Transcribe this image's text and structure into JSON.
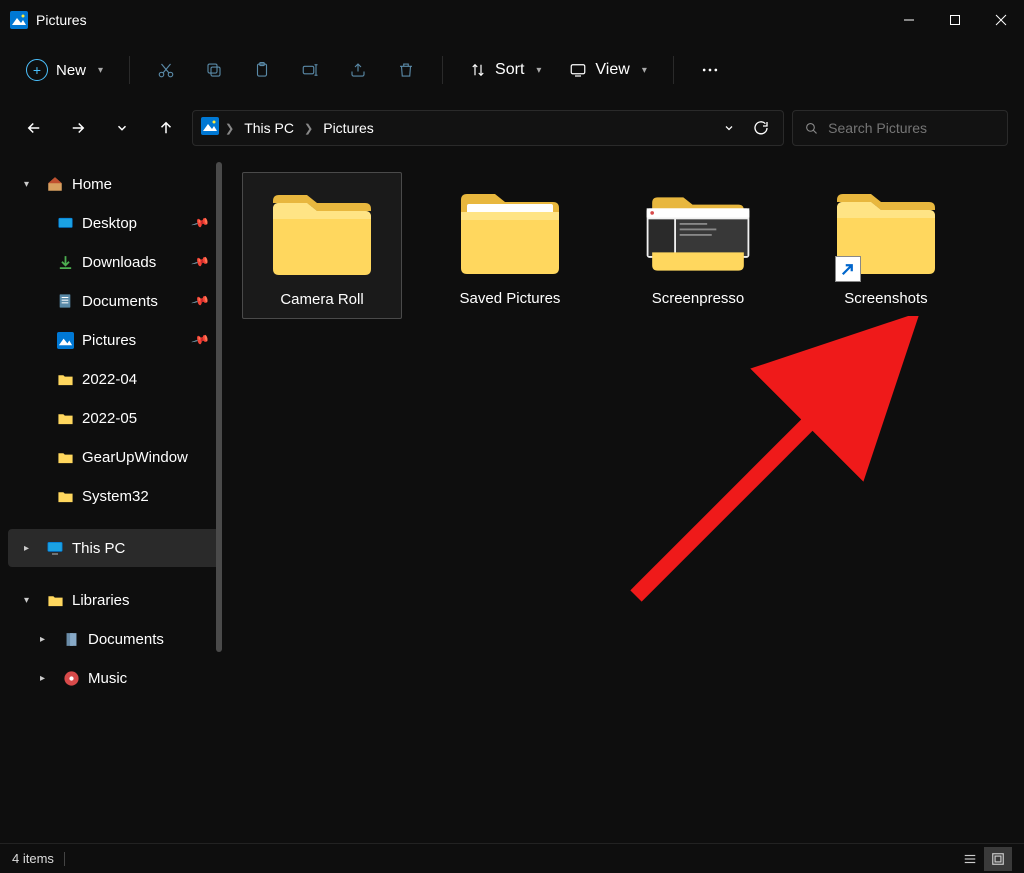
{
  "window": {
    "title": "Pictures"
  },
  "toolbar": {
    "new_label": "New",
    "sort_label": "Sort",
    "view_label": "View"
  },
  "breadcrumb": {
    "items": [
      "This PC",
      "Pictures"
    ]
  },
  "search": {
    "placeholder": "Search Pictures"
  },
  "sidebar": {
    "home_label": "Home",
    "quick": [
      {
        "label": "Desktop",
        "pinned": true,
        "icon": "desktop"
      },
      {
        "label": "Downloads",
        "pinned": true,
        "icon": "download"
      },
      {
        "label": "Documents",
        "pinned": true,
        "icon": "document"
      },
      {
        "label": "Pictures",
        "pinned": true,
        "icon": "pictures"
      },
      {
        "label": "2022-04",
        "pinned": false,
        "icon": "folder"
      },
      {
        "label": "2022-05",
        "pinned": false,
        "icon": "folder"
      },
      {
        "label": "GearUpWindow",
        "pinned": false,
        "icon": "folder"
      },
      {
        "label": "System32",
        "pinned": false,
        "icon": "folder"
      }
    ],
    "this_pc_label": "This PC",
    "libraries_label": "Libraries",
    "libraries": [
      {
        "label": "Documents",
        "icon": "lib-doc"
      },
      {
        "label": "Music",
        "icon": "lib-music"
      }
    ]
  },
  "folders": [
    {
      "label": "Camera Roll",
      "selected": true,
      "type": "folder"
    },
    {
      "label": "Saved Pictures",
      "selected": false,
      "type": "folder-open"
    },
    {
      "label": "Screenpresso",
      "selected": false,
      "type": "folder-preview"
    },
    {
      "label": "Screenshots",
      "selected": false,
      "type": "folder-shortcut"
    }
  ],
  "status": {
    "items_text": "4 items"
  }
}
